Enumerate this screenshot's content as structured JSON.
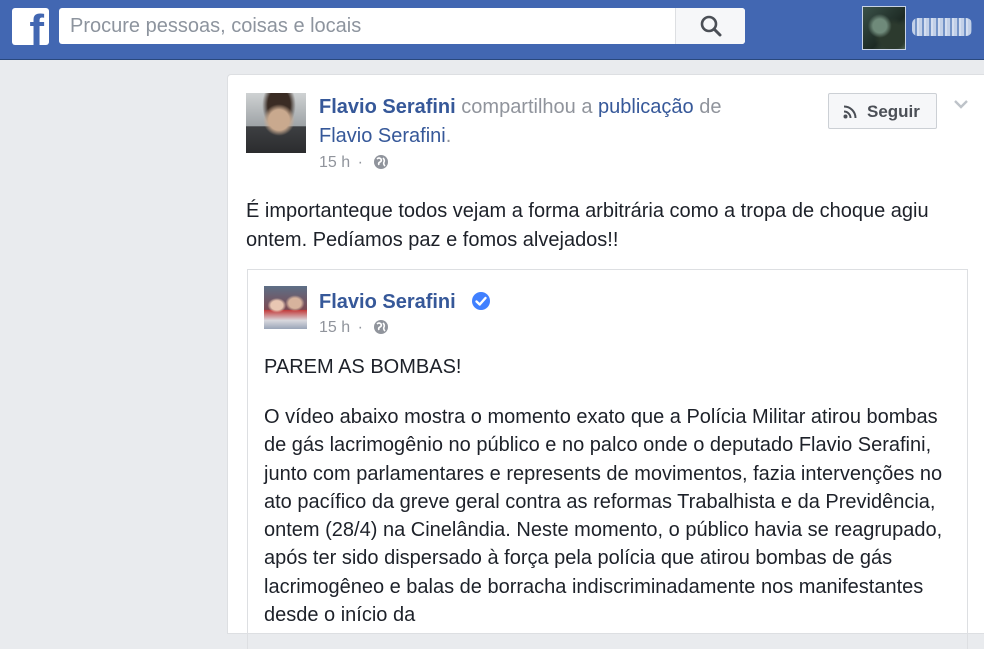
{
  "topbar": {
    "logo_letter": "f",
    "search_placeholder": "Procure pessoas, coisas e locais",
    "search_icon": "search-icon"
  },
  "post": {
    "author": "Flavio Serafini",
    "shared_text": "compartilhou a",
    "publication_link": "publicação",
    "of_text": "de",
    "original_author": "Flavio Serafini",
    "period": ".",
    "time": "15 h",
    "separator": "·",
    "privacy_icon": "globe-icon",
    "follow_label": "Seguir",
    "follow_icon": "rss-icon",
    "menu_icon": "chevron-down-icon",
    "text": "É importanteque todos vejam a forma arbitrária como a tropa de choque agiu ontem. Pedíamos paz e fomos alvejados!!"
  },
  "shared": {
    "author": "Flavio Serafini",
    "verified_icon": "verified-badge-icon",
    "time": "15 h",
    "separator": "·",
    "privacy_icon": "globe-icon",
    "title": "PAREM AS BOMBAS!",
    "body": "O vídeo abaixo mostra o momento exato que a Polícia Militar atirou bombas de gás lacrimogênio no público e no palco onde o deputado Flavio Serafini, junto com parlamentares e represents de movimentos, fazia intervenções no ato pacífico da greve geral contra as reformas Trabalhista e da Previdência, ontem (28/4) na Cinelândia. Neste momento, o público havia se reagrupado, após ter sido dispersado à força pela polícia que atirou bombas de gás lacrimogêneo e balas de borracha indiscriminadamente nos manifestantes desde o início da"
  },
  "colors": {
    "topbar": "#4267b2",
    "link": "#365899",
    "meta": "#90949c",
    "text": "#1d2129",
    "background": "#e9ebee"
  }
}
